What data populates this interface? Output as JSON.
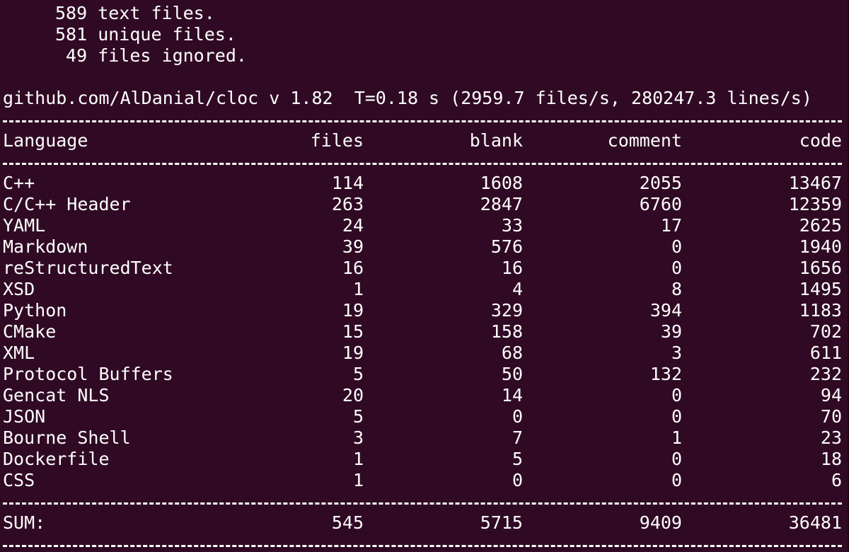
{
  "summary": {
    "text_files": "589 text files.",
    "unique_files": "581 unique files.",
    "ignored_files": " 49 files ignored."
  },
  "header": {
    "version_line": "github.com/AlDanial/cloc v 1.82  T=0.18 s (2959.7 files/s, 280247.3 lines/s)"
  },
  "table": {
    "columns": [
      "Language",
      "files",
      "blank",
      "comment",
      "code"
    ],
    "rows": [
      {
        "language": "C++",
        "files": "114",
        "blank": "1608",
        "comment": "2055",
        "code": "13467"
      },
      {
        "language": "C/C++ Header",
        "files": "263",
        "blank": "2847",
        "comment": "6760",
        "code": "12359"
      },
      {
        "language": "YAML",
        "files": "24",
        "blank": "33",
        "comment": "17",
        "code": "2625"
      },
      {
        "language": "Markdown",
        "files": "39",
        "blank": "576",
        "comment": "0",
        "code": "1940"
      },
      {
        "language": "reStructuredText",
        "files": "16",
        "blank": "16",
        "comment": "0",
        "code": "1656"
      },
      {
        "language": "XSD",
        "files": "1",
        "blank": "4",
        "comment": "8",
        "code": "1495"
      },
      {
        "language": "Python",
        "files": "19",
        "blank": "329",
        "comment": "394",
        "code": "1183"
      },
      {
        "language": "CMake",
        "files": "15",
        "blank": "158",
        "comment": "39",
        "code": "702"
      },
      {
        "language": "XML",
        "files": "19",
        "blank": "68",
        "comment": "3",
        "code": "611"
      },
      {
        "language": "Protocol Buffers",
        "files": "5",
        "blank": "50",
        "comment": "132",
        "code": "232"
      },
      {
        "language": "Gencat NLS",
        "files": "20",
        "blank": "14",
        "comment": "0",
        "code": "94"
      },
      {
        "language": "JSON",
        "files": "5",
        "blank": "0",
        "comment": "0",
        "code": "70"
      },
      {
        "language": "Bourne Shell",
        "files": "3",
        "blank": "7",
        "comment": "1",
        "code": "23"
      },
      {
        "language": "Dockerfile",
        "files": "1",
        "blank": "5",
        "comment": "0",
        "code": "18"
      },
      {
        "language": "CSS",
        "files": "1",
        "blank": "0",
        "comment": "0",
        "code": "6"
      }
    ],
    "sum": {
      "label": "SUM:",
      "files": "545",
      "blank": "5715",
      "comment": "9409",
      "code": "36481"
    }
  },
  "colors": {
    "background": "#300a24",
    "text": "#ffffff"
  }
}
